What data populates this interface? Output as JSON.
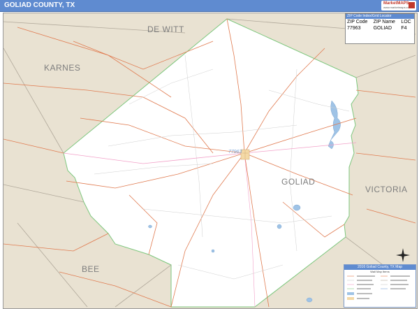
{
  "header": {
    "title": "GOLIAD COUNTY, TX",
    "logo_text": "MarketMAPS",
    "logo_sub": "www.marketmaps.com"
  },
  "map": {
    "county_labels": {
      "dewitt": "DE WITT",
      "karnes": "KARNES",
      "goliad": "GOLIAD",
      "victoria": "VICTORIA",
      "bee": "BEE"
    },
    "zip_label": "77963",
    "colors": {
      "county_fill": "#ffffff",
      "surrounding": "#e9e2d2",
      "roads_major": "#e07a4f",
      "roads_minor": "#c9c9c9",
      "water": "#9fc3e6",
      "border": "#7dc77d",
      "highway": "#f2a0c8"
    }
  },
  "zip_table": {
    "header": "ZIP Code Index/Grid Locator",
    "columns": [
      "ZIP Code",
      "ZIP Name",
      "LOC"
    ],
    "rows": [
      [
        "77963",
        "GOLIAD",
        "F4"
      ]
    ]
  },
  "legend": {
    "title": "2016 Goliad County, TX Map",
    "subtitle": "Wall Map Items"
  }
}
